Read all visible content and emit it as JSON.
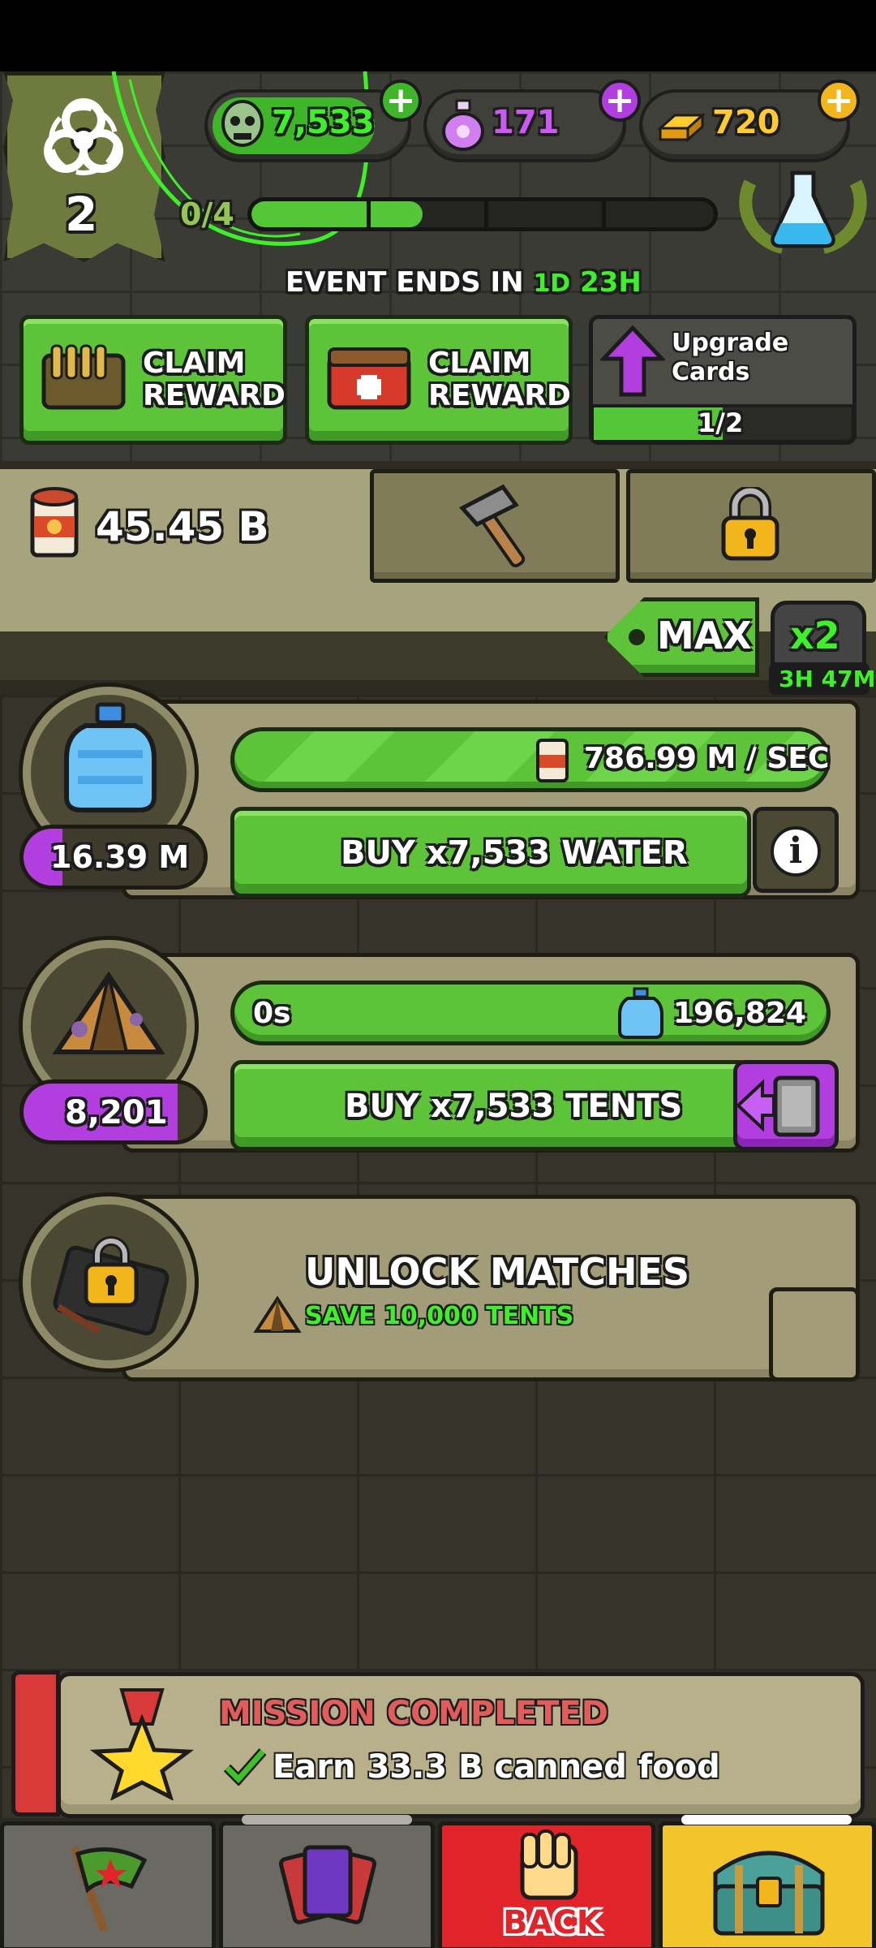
{
  "currencies": {
    "zombies": "7,533",
    "potions": "171",
    "gold": "720"
  },
  "level": "2",
  "event": {
    "progress_text": "0/4",
    "progress_fraction": 0.37,
    "ends_label": "EVENT ENDS IN",
    "ends_days": "1D",
    "ends_hours": "23H"
  },
  "rewards": [
    {
      "label1": "CLAIM",
      "label2": "REWARD"
    },
    {
      "label1": "CLAIM",
      "label2": "REWARD"
    }
  ],
  "upgrade": {
    "label1": "Upgrade",
    "label2": "Cards",
    "progress": "1/2",
    "progress_fraction": 0.5
  },
  "canned_food_total": "45.45 B",
  "multiplier": {
    "max_label": "MAX",
    "boost_label": "x2",
    "boost_timer": "3H 47M"
  },
  "water": {
    "rate": "786.99 M / SEC",
    "count": "16.39 M",
    "buy_label": "BUY x7,533 WATER"
  },
  "tents": {
    "timer": "0s",
    "cost": "196,824",
    "count": "8,201",
    "buy_label": "BUY x7,533 TENTS"
  },
  "matches": {
    "title": "UNLOCK MATCHES",
    "requirement": "SAVE 10,000 TENTS"
  },
  "mission": {
    "status": "MISSION COMPLETED",
    "text": "Earn 33.3 B canned food"
  },
  "nav": {
    "back_label": "BACK"
  },
  "colors": {
    "accent_green": "#5dc43a",
    "purple": "#b23ee0",
    "gold": "#f2b51c",
    "danger_red": "#e0242a",
    "mission_red": "#e35c5c"
  }
}
